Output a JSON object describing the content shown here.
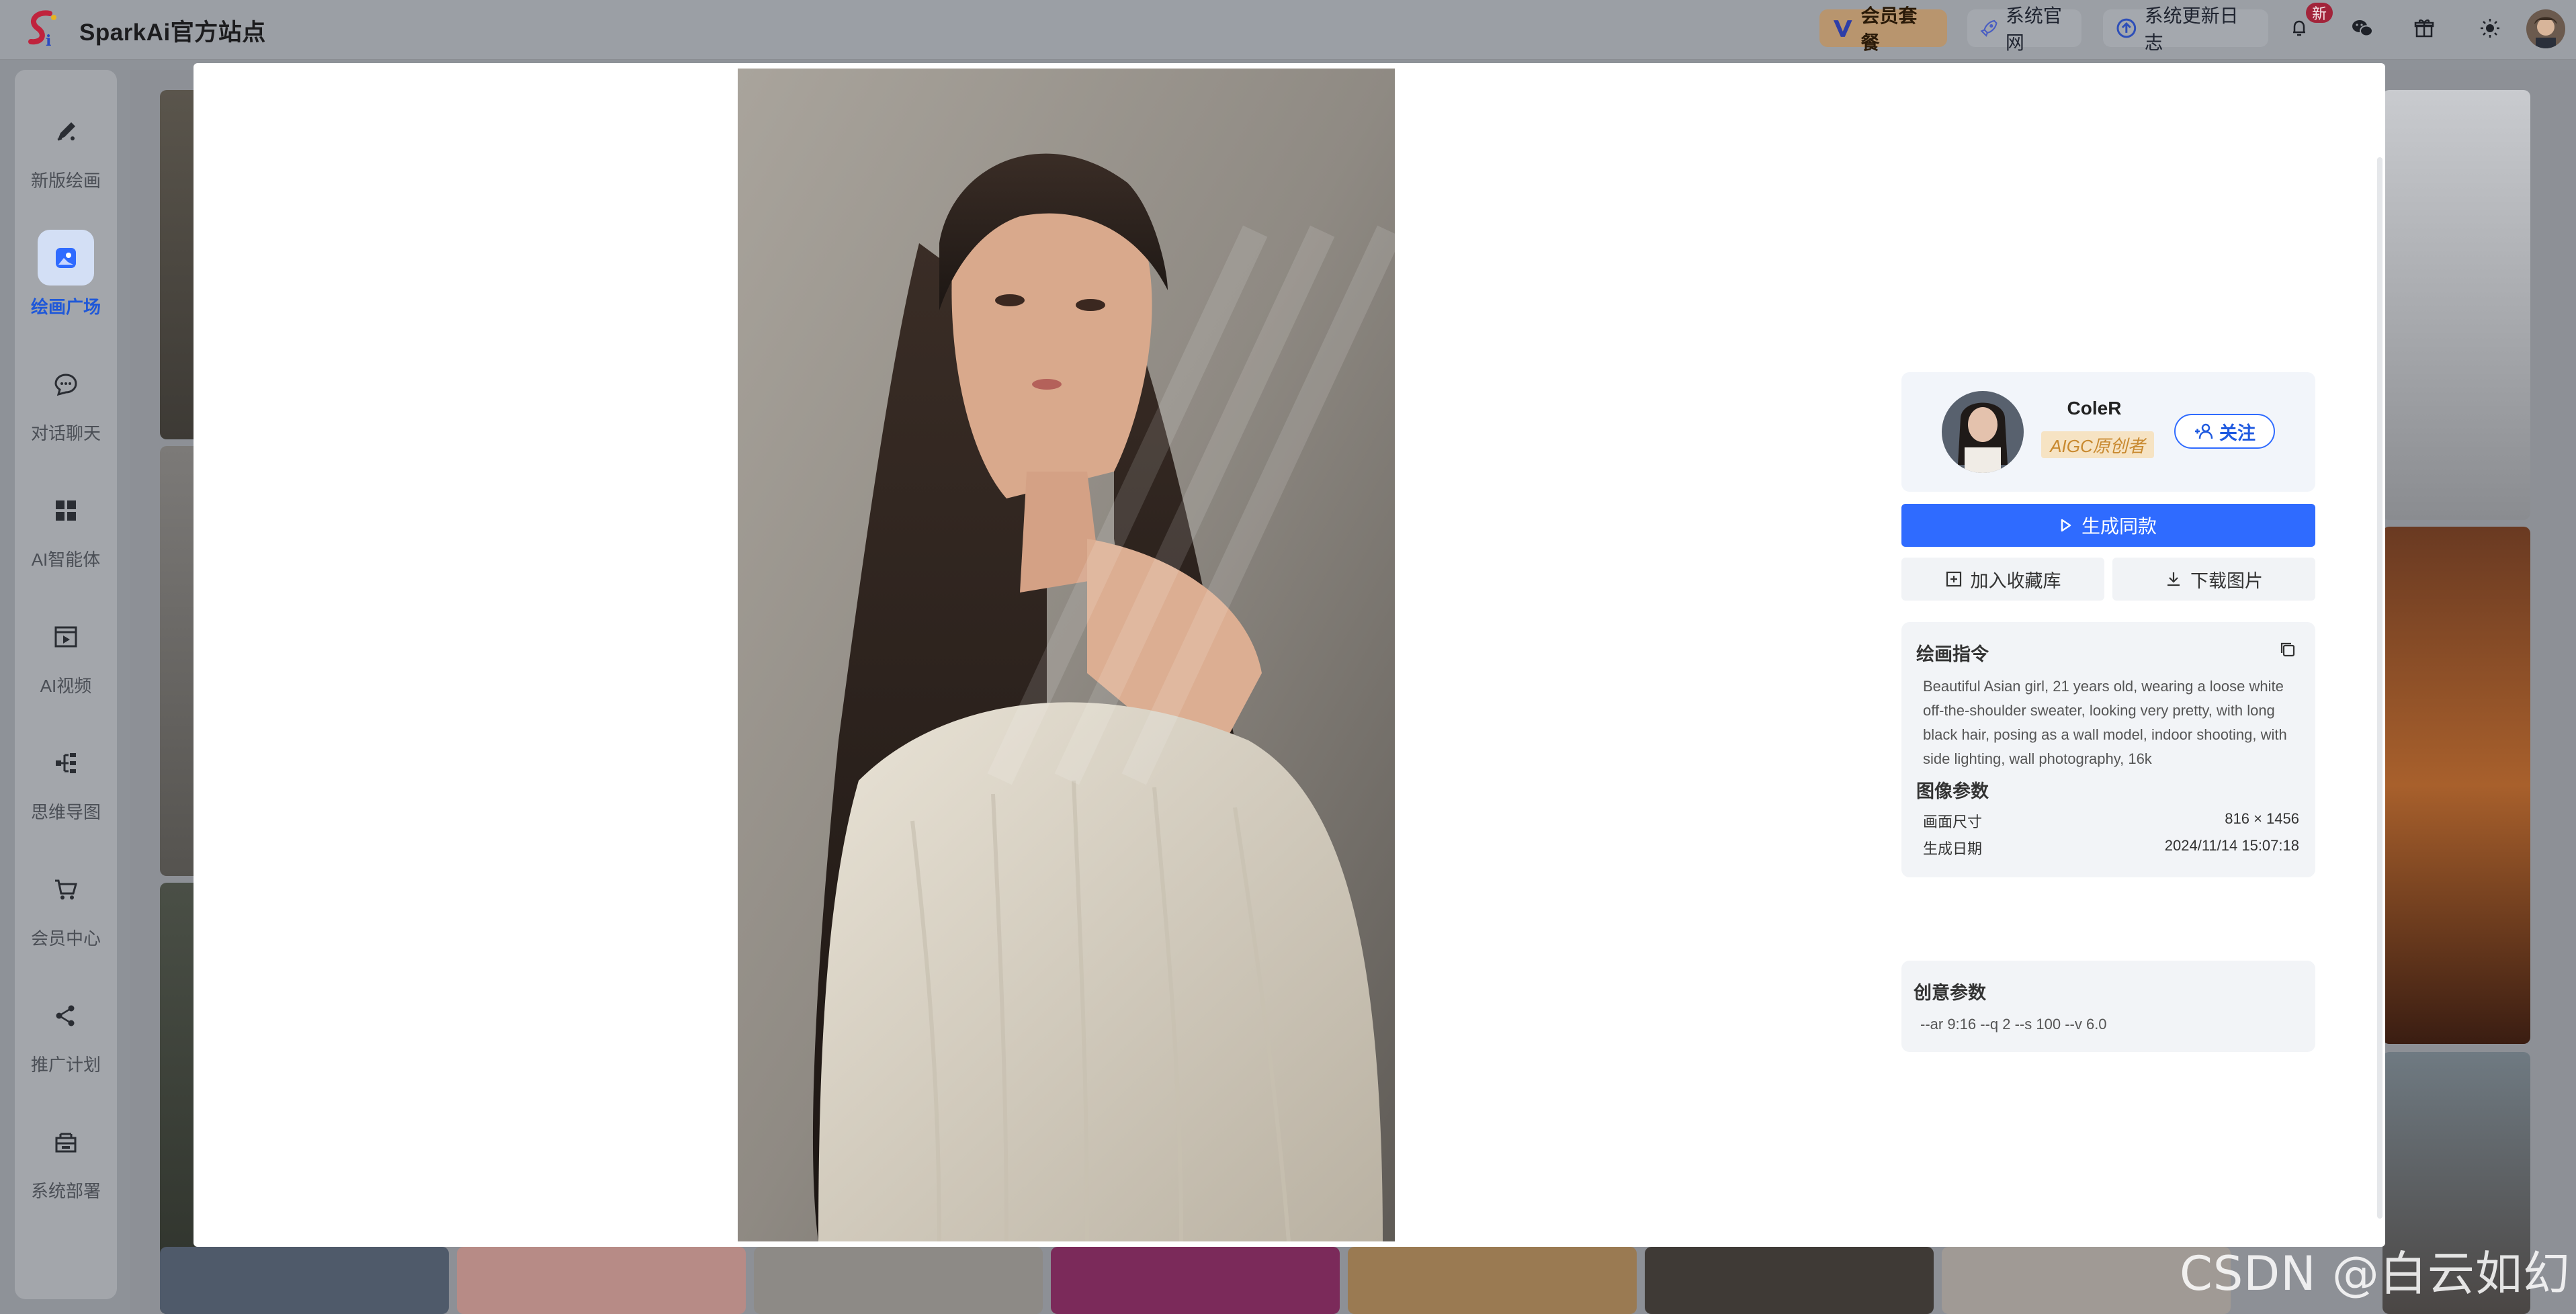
{
  "header": {
    "brand": "SparkAi官方站点",
    "member_label": "会员套餐",
    "official_label": "系统官网",
    "changelog_label": "系统更新日志",
    "new_badge": "新"
  },
  "sidebar": {
    "items": [
      {
        "label": "新版绘画",
        "icon": "brush-icon"
      },
      {
        "label": "绘画广场",
        "icon": "gallery-icon"
      },
      {
        "label": "对话聊天",
        "icon": "chat-icon"
      },
      {
        "label": "AI智能体",
        "icon": "grid-icon"
      },
      {
        "label": "AI视频",
        "icon": "video-icon"
      },
      {
        "label": "思维导图",
        "icon": "mindmap-icon"
      },
      {
        "label": "会员中心",
        "icon": "cart-icon"
      },
      {
        "label": "推广计划",
        "icon": "share-icon"
      },
      {
        "label": "系统部署",
        "icon": "deploy-icon"
      }
    ],
    "active_index": 1
  },
  "detail": {
    "author_name": "ColeR",
    "author_badge": "AIGC原创者",
    "follow_label": "关注",
    "generate_label": "生成同款",
    "collect_label": "加入收藏库",
    "download_label": "下载图片",
    "prompt_title": "绘画指令",
    "prompt_text": "Beautiful Asian girl, 21 years old, wearing a loose white off-the-shoulder sweater, looking very pretty, with long black hair, posing as a wall model, indoor shooting, with side lighting, wall photography, 16k",
    "params_title": "图像参数",
    "size_label": "画面尺寸",
    "size_value": "816 × 1456",
    "date_label": "生成日期",
    "date_value": "2024/11/14 15:07:18",
    "creative_title": "创意参数",
    "creative_value": "--ar 9:16 --q 2 --s 100 --v 6.0"
  },
  "watermark": "CSDN @白云如幻",
  "colors": {
    "accent": "#2f6bff",
    "badge_text": "#c8892f",
    "badge_bg": "#f6e3c3"
  }
}
